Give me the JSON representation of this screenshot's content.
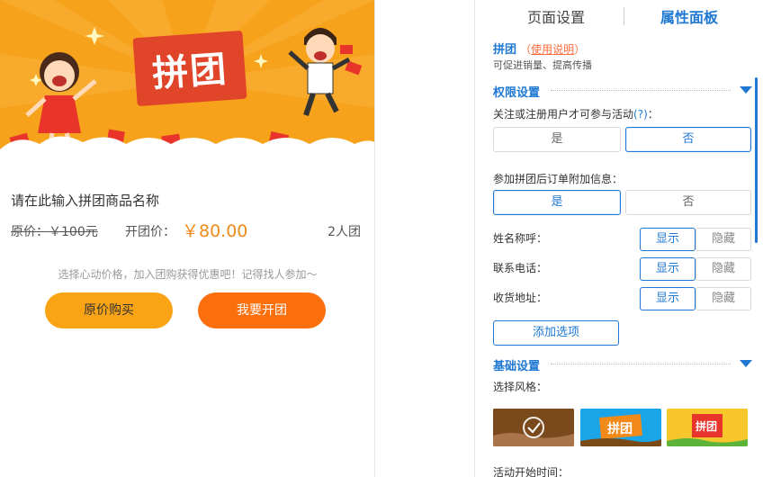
{
  "preview": {
    "banner_title": "拼团",
    "product_name": "请在此输入拼团商品名称",
    "original_price_label": "原价：￥100元",
    "group_price_label": "开团价：",
    "group_price": "￥80.00",
    "team_size": "2人团",
    "hint": "选择心动价格，加入团购获得优惠吧！记得找人参加～",
    "buy_button": "原价购买",
    "group_button": "我要开团"
  },
  "panel": {
    "tabs": [
      "页面设置",
      "属性面板"
    ],
    "active_tab": "属性面板",
    "title": "拼团",
    "help_open": "（",
    "help_link": "使用说明",
    "help_close": "）",
    "subtitle": "可促进销量、提高传播",
    "permissions_section": "权限设置",
    "permission_question": "关注或注册用户才可参与活动",
    "permission_q_mark": "(?)",
    "permission_colon": "：",
    "permission_options": {
      "yes": "是",
      "no": "否",
      "selected": "否"
    },
    "order_info_question": "参加拼团后订单附加信息：",
    "order_info_options": {
      "yes": "是",
      "no": "否",
      "selected": "是"
    },
    "fields": [
      {
        "label": "姓名称呼：",
        "show": "显示",
        "hide": "隐藏",
        "selected": "显示"
      },
      {
        "label": "联系电话：",
        "show": "显示",
        "hide": "隐藏",
        "selected": "显示"
      },
      {
        "label": "收货地址：",
        "show": "显示",
        "hide": "隐藏",
        "selected": "显示"
      }
    ],
    "add_option": "添加选项",
    "basic_section": "基础设置",
    "style_label": "选择风格：",
    "style_thumb_texts": [
      "拼团",
      "拼团"
    ],
    "start_time_label": "活动开始时间："
  },
  "colors": {
    "accent": "#1f78d1",
    "banner_orange": "#f7a21b",
    "price_orange": "#f08a1a",
    "buy_button": "#f9a315",
    "group_button": "#fb6f0c"
  }
}
